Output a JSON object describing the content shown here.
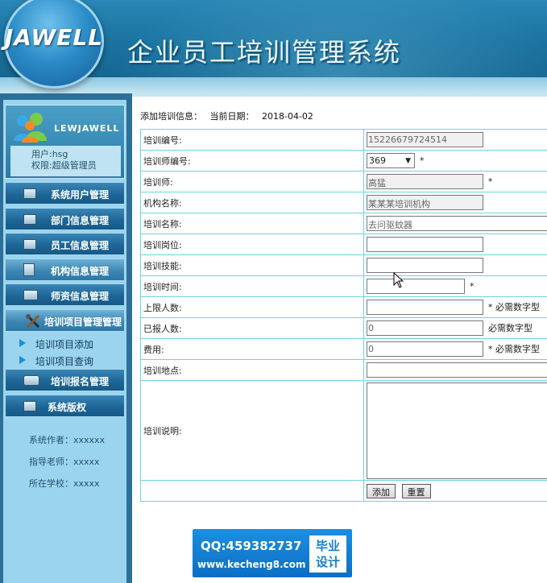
{
  "header": {
    "logo_text": "JAWELL",
    "system_title": "企业员工培训管理系统"
  },
  "sidebar": {
    "brand": "LEWJAWELL",
    "user_line": "用户:hsg",
    "role_line": "权限:超级管理员",
    "menu": [
      {
        "label": "系统用户管理",
        "icon": "folder-icon"
      },
      {
        "label": "部门信息管理",
        "icon": "folder-icon"
      },
      {
        "label": "员工信息管理",
        "icon": "folder-icon"
      },
      {
        "label": "机构信息管理",
        "icon": "book-icon"
      },
      {
        "label": "师资信息管理",
        "icon": "envelope-icon"
      },
      {
        "label": "培训项目管理管理",
        "icon": "tools-icon"
      },
      {
        "label": "培训报名管理",
        "icon": "chat-icon"
      },
      {
        "label": "系统版权",
        "icon": "folder-icon"
      }
    ],
    "submenu": [
      {
        "label": "培训项目添加"
      },
      {
        "label": "培训项目查询"
      }
    ],
    "footer": {
      "author": "系统作者：xxxxxx",
      "teacher": "指导老师：xxxxx",
      "school": "所在学校：xxxxx"
    }
  },
  "form": {
    "heading": "添加培训信息：",
    "date_label": "当前日期：",
    "date_value": "2018-04-02",
    "rows": [
      {
        "label": "培训编号:",
        "value": "15226679724514"
      },
      {
        "label": "培训师编号:",
        "value": "369",
        "suffix": "*"
      },
      {
        "label": "培训师:",
        "value": "高猛",
        "suffix": "*"
      },
      {
        "label": "机构名称:",
        "value": "某某某培训机构"
      },
      {
        "label": "培训名称:",
        "value": "去问驱蚊器"
      },
      {
        "label": "培训岗位:",
        "value": ""
      },
      {
        "label": "培训技能:",
        "value": ""
      },
      {
        "label": "培训时间:",
        "value": "",
        "suffix": "*"
      },
      {
        "label": "上限人数:",
        "value": "",
        "suffix": "* 必需数字型"
      },
      {
        "label": "已报人数:",
        "value": "0",
        "suffix": "必需数字型"
      },
      {
        "label": "费用:",
        "value": "0",
        "suffix": "* 必需数字型"
      },
      {
        "label": "培训地点:",
        "value": ""
      },
      {
        "label": "培训说明:",
        "value": ""
      }
    ],
    "add_button": "添加",
    "reset_button": "重置"
  },
  "banner": {
    "qq": "QQ:459382737",
    "site": "www.kecheng8.com",
    "box_line1": "毕业",
    "box_line2": "设计"
  }
}
